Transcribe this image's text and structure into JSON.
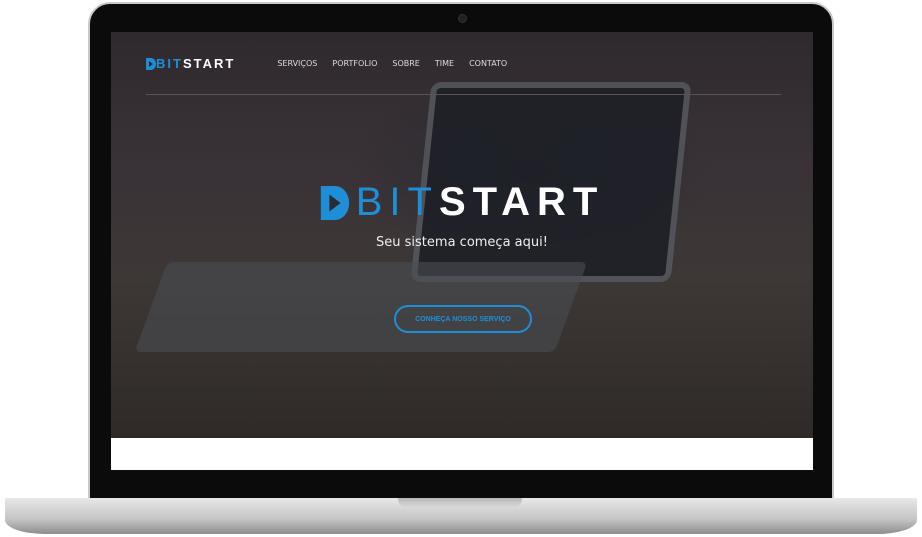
{
  "nav": {
    "logo_a": "BIT",
    "logo_b": "START",
    "items": [
      "SERVIÇOS",
      "PORTFOLIO",
      "SOBRE",
      "TIME",
      "CONTATO"
    ]
  },
  "hero": {
    "logo_a": "BIT",
    "logo_b": "START",
    "tagline": "Seu sistema começa aqui!",
    "cta": "CONHEÇA NOSSO SERVIÇO"
  },
  "colors": {
    "accent": "#1e8fd6"
  }
}
